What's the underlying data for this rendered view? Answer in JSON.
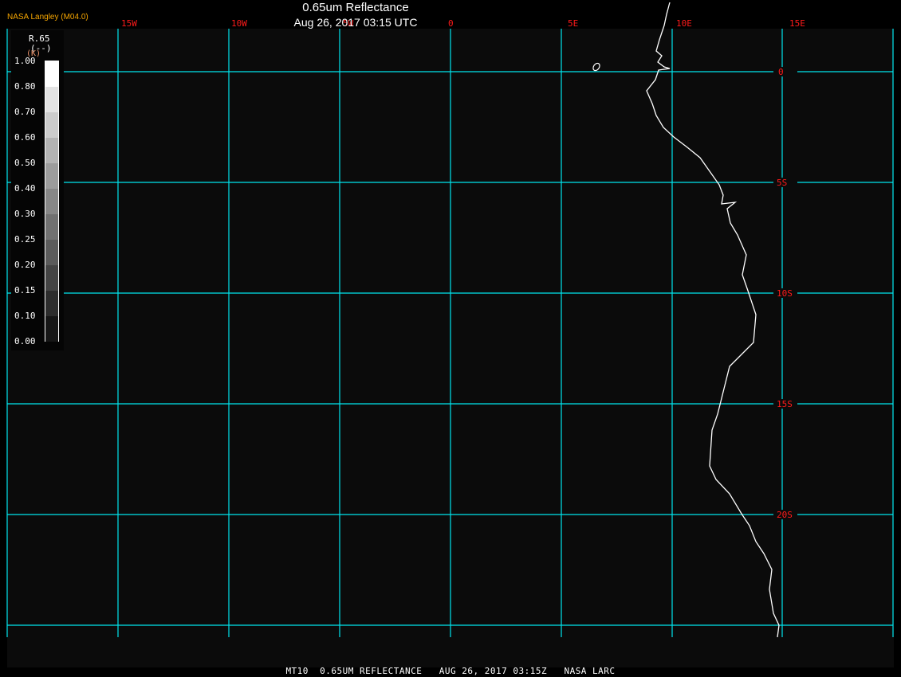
{
  "header": {
    "title": "0.65um Reflectance",
    "subtitle": "Aug 26, 2017 03:15 UTC",
    "brand": "NASA Langley (M04.0)"
  },
  "legend": {
    "variable": "R.65",
    "units": "(--)",
    "units_overlay": "(K)",
    "ticks": [
      "1.00",
      "0.80",
      "0.70",
      "0.60",
      "0.50",
      "0.40",
      "0.30",
      "0.25",
      "0.20",
      "0.15",
      "0.10",
      "0.00"
    ],
    "colors": [
      "#ffffff",
      "#e3e3e3",
      "#cccccc",
      "#b3b3b3",
      "#9c9c9c",
      "#878787",
      "#717171",
      "#5b5b5b",
      "#444444",
      "#2d2d2d",
      "#161616"
    ]
  },
  "map": {
    "longitude_labels": [
      "15W",
      "10W",
      "5W",
      "0",
      "5E",
      "10E",
      "15E"
    ],
    "latitude_labels": [
      "0",
      "5S",
      "10S",
      "15S",
      "20S"
    ],
    "grid_color": "#00e5ee",
    "label_color": "#ff1a1a",
    "coastline_color": "#ffffff",
    "background": "#0b0b0b"
  },
  "footer": {
    "caption": "MT10  0.65UM REFLECTANCE   AUG 26, 2017 03:15Z   NASA LARC"
  }
}
